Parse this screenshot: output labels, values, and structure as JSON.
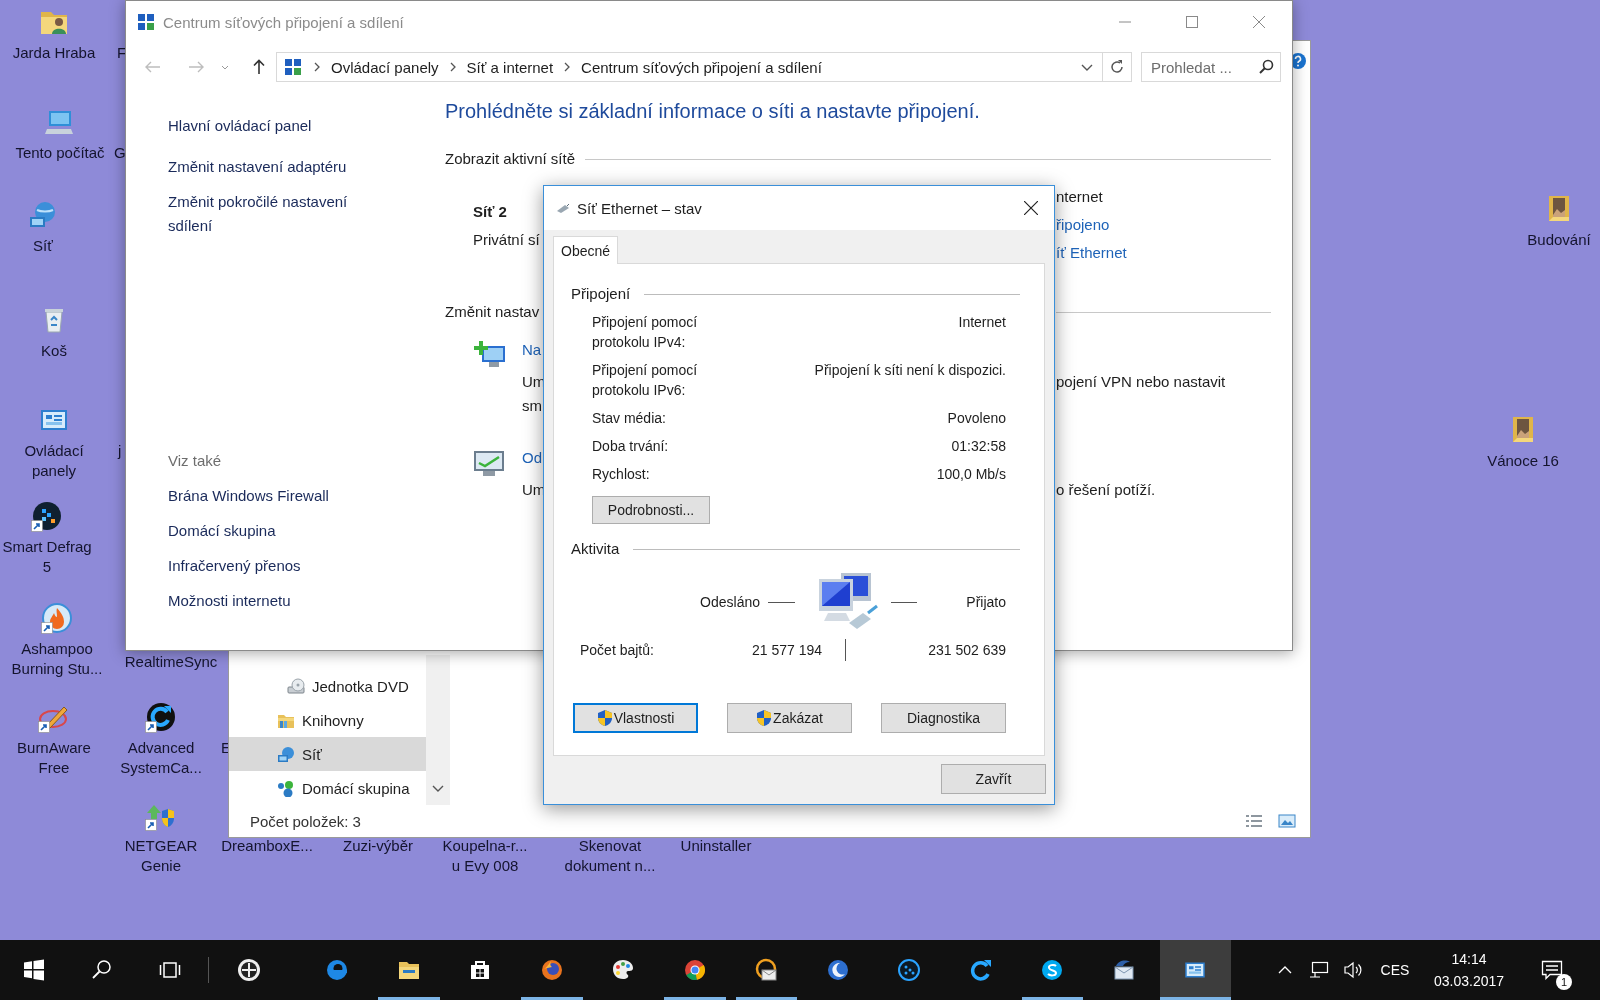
{
  "network_center": {
    "title": "Centrum síťových připojení a sdílení",
    "breadcrumb": [
      "Ovládací panely",
      "Síť a internet",
      "Centrum síťových připojení a sdílení"
    ],
    "search": {
      "placeholder": "Prohledat ..."
    },
    "sidebar": {
      "links": [
        "Hlavní ovládací panel",
        "Změnit nastavení adaptéru",
        "Změnit pokročilé nastavení sdílení"
      ],
      "see_also_title": "Viz také",
      "see_also": [
        "Brána Windows Firewall",
        "Domácí skupina",
        "Infračervený přenos",
        "Možnosti internetu"
      ]
    },
    "heading": "Prohlédněte si základní informace o síti a nastavte připojení.",
    "active_networks_title": "Zobrazit aktivní sítě",
    "network_name": "Síť 2",
    "network_type": "Privátní sí",
    "access_type": "nternet",
    "connection_status": "řipojeno",
    "connection_link": "íť Ethernet",
    "change_title": "Změnit nastav",
    "tasks": [
      {
        "kind": "new-connection",
        "link": "Na",
        "description_lines": [
          "Um",
          "sm"
        ],
        "right_lines": [
          "pojení VPN nebo nastavit"
        ]
      },
      {
        "kind": "troubleshoot",
        "link": "Od",
        "description_lines": [
          "Um"
        ],
        "right_lines": [
          "o řešení potíží."
        ]
      }
    ]
  },
  "status_dialog": {
    "title": "Síť Ethernet – stav",
    "tabs": [
      {
        "label": "Obecné",
        "selected": true
      }
    ],
    "connection_title": "Připojení",
    "fields": [
      {
        "label": "Připojení pomocí protokolu IPv4:",
        "value": "Internet"
      },
      {
        "label": "Připojení pomocí protokolu IPv6:",
        "value": "Připojení k síti není k dispozici."
      },
      {
        "label": "Stav média:",
        "value": "Povoleno"
      },
      {
        "label": "Doba trvání:",
        "value": "01:32:58"
      },
      {
        "label": "Rychlost:",
        "value": "100,0 Mb/s"
      }
    ],
    "details_button": "Podrobnosti...",
    "activity_title": "Aktivita",
    "sent_label": "Odesláno",
    "received_label": "Přijato",
    "bytes_label": "Počet bajtů:",
    "bytes_sent": "21 577 194",
    "bytes_received": "231 502 639",
    "buttons": [
      {
        "label": "Vlastnosti",
        "shield": true,
        "focused": true
      },
      {
        "label": "Zakázat",
        "shield": true,
        "focused": false
      },
      {
        "label": "Diagnostika",
        "shield": false,
        "focused": false
      }
    ],
    "close_button": "Zavřít"
  },
  "explorer": {
    "nav": [
      {
        "kind": "dvd",
        "label": "Jednotka DVD",
        "selected": false
      },
      {
        "kind": "libraries",
        "label": "Knihovny",
        "selected": false
      },
      {
        "kind": "network",
        "label": "Síť",
        "selected": true
      },
      {
        "kind": "homegroup",
        "label": "Domácí skupina",
        "selected": false
      }
    ],
    "status": "Počet položek: 3"
  },
  "desktop": {
    "icons": [
      {
        "kind": "user-folder",
        "label_lines": [
          "Jarda Hraba"
        ],
        "shortcut": false
      },
      {
        "kind": "none",
        "label_lines": [
          "F"
        ]
      },
      {
        "kind": "computer",
        "label_lines": [
          "Tento počítač"
        ],
        "shortcut": false
      },
      {
        "kind": "none",
        "label_lines": [
          "G"
        ]
      },
      {
        "kind": "network",
        "label_lines": [
          "Síť"
        ],
        "shortcut": false
      },
      {
        "kind": "recycle-bin",
        "label_lines": [
          "Koš"
        ],
        "shortcut": false
      },
      {
        "kind": "control-panel",
        "label_lines": [
          "Ovládací",
          "panely"
        ],
        "shortcut": false
      },
      {
        "kind": "none",
        "label_lines": [
          "j"
        ]
      },
      {
        "kind": "defrag",
        "label_lines": [
          "Smart Defrag",
          "5"
        ],
        "shortcut": true
      },
      {
        "kind": "flame",
        "label_lines": [
          "Ashampoo",
          "Burning Stu..."
        ],
        "shortcut": true
      },
      {
        "kind": "none",
        "label_lines": [
          "RealtimeSync"
        ]
      },
      {
        "kind": "pen",
        "label_lines": [
          "BurnAware",
          "Free"
        ],
        "shortcut": true
      },
      {
        "kind": "refresh-app",
        "label_lines": [
          "Advanced",
          "SystemCa..."
        ],
        "shortcut": true
      },
      {
        "kind": "none",
        "label_lines": [
          "E"
        ]
      },
      {
        "kind": "netgear",
        "label_lines": [
          "NETGEAR",
          "Genie"
        ],
        "shortcut": true
      },
      {
        "kind": "none",
        "label_lines": [
          "DreamboxE..."
        ]
      },
      {
        "kind": "none",
        "label_lines": [
          "Zuzi-výběr"
        ]
      },
      {
        "kind": "none",
        "label_lines": [
          "Koupelna-r...",
          "u Evy 008"
        ]
      },
      {
        "kind": "none",
        "label_lines": [
          "Skenovat",
          "dokument n..."
        ]
      },
      {
        "kind": "none",
        "label_lines": [
          "Uninstaller"
        ]
      },
      {
        "kind": "photo-folder",
        "label_lines": [
          "Budování"
        ],
        "shortcut": false
      },
      {
        "kind": "photo-folder",
        "label_lines": [
          "Vánoce 16"
        ],
        "shortcut": false
      }
    ]
  },
  "taskbar": {
    "items": [
      {
        "kind": "start",
        "running": false,
        "active": false
      },
      {
        "kind": "search",
        "running": false,
        "active": false
      },
      {
        "kind": "task-view",
        "running": false,
        "active": false
      },
      {
        "kind": "circle-app",
        "running": false,
        "active": false
      },
      {
        "kind": "edge",
        "running": false,
        "active": false
      },
      {
        "kind": "explorer",
        "running": true,
        "active": false
      },
      {
        "kind": "store",
        "running": false,
        "active": false
      },
      {
        "kind": "firefox",
        "running": true,
        "active": false
      },
      {
        "kind": "paint",
        "running": false,
        "active": false
      },
      {
        "kind": "chrome",
        "running": true,
        "active": false
      },
      {
        "kind": "mail",
        "running": true,
        "active": false
      },
      {
        "kind": "moon",
        "running": false,
        "active": false
      },
      {
        "kind": "dots",
        "running": false,
        "active": false
      },
      {
        "kind": "advanced-care",
        "running": false,
        "active": false
      },
      {
        "kind": "skype",
        "running": true,
        "active": false
      },
      {
        "kind": "thunderbird",
        "running": false,
        "active": false
      },
      {
        "kind": "control-panel",
        "running": true,
        "active": true
      }
    ],
    "language": "CES",
    "time": "14:14",
    "date": "03.03.2017",
    "notification_count": "1"
  }
}
